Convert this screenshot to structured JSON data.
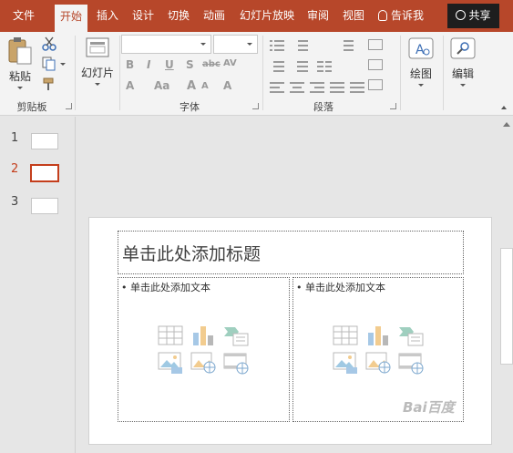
{
  "ribbon_tabs": [
    "文件",
    "开始",
    "插入",
    "设计",
    "切换",
    "动画",
    "幻灯片放映",
    "审阅",
    "视图"
  ],
  "tell_me": "告诉我",
  "share_label": "共享",
  "groups": {
    "clipboard": {
      "label": "剪贴板",
      "paste_label": "粘贴"
    },
    "slides": {
      "label": "幻灯片",
      "new_slide_label": "幻灯片"
    },
    "font": {
      "label": "字体",
      "font_name_value": "",
      "font_size_value": ""
    },
    "paragraph": {
      "label": "段落"
    },
    "drawing": {
      "label": "绘图"
    },
    "editing": {
      "label": "编辑"
    }
  },
  "thumbnails": [
    {
      "number": "1",
      "selected": false
    },
    {
      "number": "2",
      "selected": true
    },
    {
      "number": "3",
      "selected": false
    }
  ],
  "slide": {
    "title_placeholder": "单击此处添加标题",
    "left_content_placeholder": "• 单击此处添加文本",
    "right_content_placeholder": "• 单击此处添加文本",
    "content_icons": [
      "table-icon",
      "chart-icon",
      "smartart-icon",
      "picture-icon",
      "online-picture-icon",
      "video-icon"
    ]
  },
  "watermark": "Bai百度",
  "colors": {
    "accent": "#b7472a",
    "selection": "#c43e1c",
    "share_bg": "#1e1e1e"
  }
}
